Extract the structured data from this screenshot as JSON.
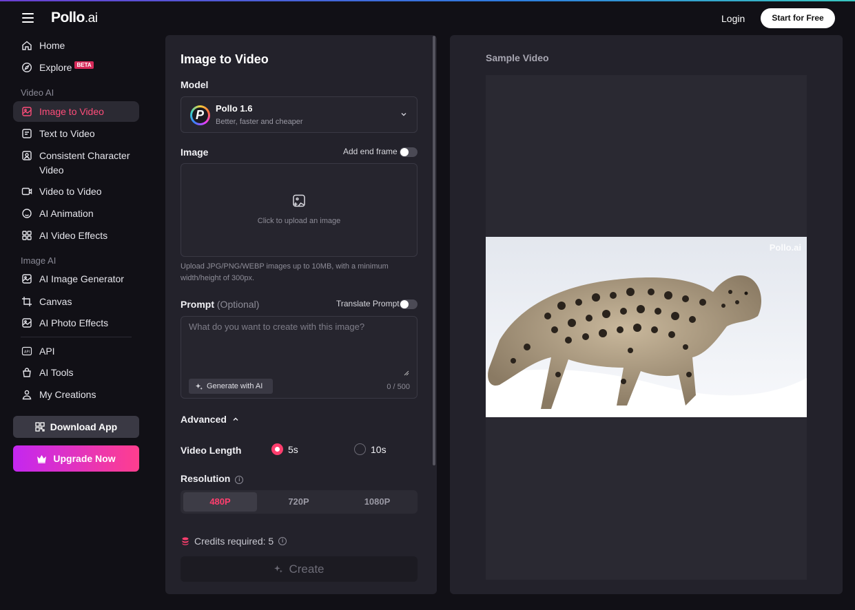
{
  "header": {
    "logo_main": "Pollo",
    "logo_suffix": ".ai",
    "login_label": "Login",
    "start_label": "Start for Free"
  },
  "sidebar": {
    "home": "Home",
    "explore": "Explore",
    "explore_badge": "BETA",
    "video_section": "Video AI",
    "image_to_video": "Image to Video",
    "text_to_video": "Text to Video",
    "consistent_character": "Consistent Character Video",
    "video_to_video": "Video to Video",
    "ai_animation": "AI Animation",
    "ai_video_effects": "AI Video Effects",
    "image_section": "Image AI",
    "ai_image_generator": "AI Image Generator",
    "canvas": "Canvas",
    "ai_photo_effects": "AI Photo Effects",
    "api": "API",
    "ai_tools": "AI Tools",
    "my_creations": "My Creations",
    "download_app": "Download App",
    "upgrade_now": "Upgrade Now"
  },
  "form": {
    "title": "Image to Video",
    "model_label": "Model",
    "model_name": "Pollo 1.6",
    "model_desc": "Better, faster and cheaper",
    "model_logo_letter": "P",
    "image_label": "Image",
    "end_frame_label": "Add end frame",
    "end_frame_enabled": false,
    "upload_text": "Click to upload an image",
    "upload_hint": "Upload JPG/PNG/WEBP images up to 10MB, with a minimum width/height of 300px.",
    "prompt_label": "Prompt",
    "prompt_optional": "(Optional)",
    "translate_label": "Translate Prompt",
    "translate_enabled": false,
    "prompt_placeholder": "What do you want to create with this image?",
    "prompt_value": "",
    "generate_ai_label": "Generate with AI",
    "char_count": "0 / 500",
    "advanced_label": "Advanced",
    "video_length_label": "Video Length",
    "length_options": [
      "5s",
      "10s"
    ],
    "length_selected": "5s",
    "resolution_label": "Resolution",
    "resolution_options": [
      "480P",
      "720P",
      "1080P"
    ],
    "resolution_selected": "480P",
    "credits_text": "Credits required: 5",
    "create_label": "Create"
  },
  "preview": {
    "label": "Sample Video",
    "watermark": "Pollo.ai"
  },
  "colors": {
    "accent": "#ff3e6e",
    "bg": "#111016",
    "panel": "#23222b",
    "upgrade_gradient": [
      "#c427f0",
      "#ff3e8e"
    ]
  }
}
